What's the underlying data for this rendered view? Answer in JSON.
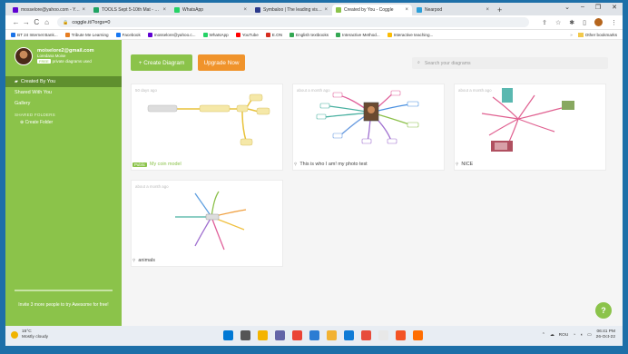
{
  "browser": {
    "tabs": [
      {
        "title": "mosselore@yahoo.com - Yahoo Mail",
        "color": "#6001d2",
        "active": false
      },
      {
        "title": "TOOLS Sept 5-10th Mat - Google Drive",
        "color": "#1fa463",
        "active": false
      },
      {
        "title": "WhatsApp",
        "color": "#25d366",
        "active": false
      },
      {
        "title": "Symbaloo | The leading visual bookmarking",
        "color": "#2b3a8c",
        "active": false
      },
      {
        "title": "Created by You - Coggle",
        "color": "#8bc34a",
        "active": true
      },
      {
        "title": "Nearpod",
        "color": "#2b9fd9",
        "active": false
      }
    ],
    "url": "coggle.it/?orgs=0",
    "bookmarks": [
      {
        "label": "BT 24 Internet Bank...",
        "color": "#1a73e8"
      },
      {
        "label": "Tribute Me Learning",
        "color": "#e67e22"
      },
      {
        "label": "Facebook",
        "color": "#1877f2"
      },
      {
        "label": "mosselore@yahoo.c...",
        "color": "#6001d2"
      },
      {
        "label": "WhatsApp",
        "color": "#25d366"
      },
      {
        "label": "YouTube",
        "color": "#ff0000"
      },
      {
        "label": "E.ON",
        "color": "#d62d20"
      },
      {
        "label": "English textbooks",
        "color": "#34a853"
      },
      {
        "label": "Interactive Method...",
        "color": "#34a853"
      },
      {
        "label": "Interactive teaching...",
        "color": "#fbbc04"
      }
    ],
    "other_bookmarks": "Other bookmarks"
  },
  "sidebar": {
    "email": "moiselore2@gmail.com",
    "name": "Loredana Moise",
    "plan_badge": "FREE",
    "plan_text": "private diagrams used",
    "items": [
      {
        "label": "Created By You",
        "active": true
      },
      {
        "label": "Shared With You",
        "active": false
      },
      {
        "label": "Gallery",
        "active": false
      }
    ],
    "shared_folders_heading": "SHARED FOLDERS",
    "create_folder": "Create Folder",
    "invite_text": "Invite 3 more people to try Awesome for free!",
    "invite_progress": 0.0
  },
  "main": {
    "create_label": "+ Create Diagram",
    "upgrade_label": "Upgrade Now",
    "search_placeholder": "Search your diagrams",
    "cards": [
      {
        "age": "50 days ago",
        "badge": "Public",
        "title": "My coin model",
        "locked": false
      },
      {
        "age": "about a month ago",
        "title": "This is who I am! my photo test",
        "locked": true
      },
      {
        "age": "about a month ago",
        "title": "NICE",
        "locked": true
      },
      {
        "age": "about a month ago",
        "title": "animals",
        "locked": true
      }
    ],
    "help_label": "?"
  },
  "taskbar": {
    "temperature": "15°C",
    "weather": "Mostly cloudy",
    "language": "ROU",
    "time": "06:41 PM",
    "date": "26-Oct-22",
    "app_colors": [
      "#0078d4",
      "#555555",
      "#f4b400",
      "#6264a7",
      "#ea4335",
      "#2b7cd3",
      "#f2b233",
      "#0f7bd6",
      "#e74c3c",
      "#e8e8e8",
      "#f35325",
      "#ff6d00"
    ]
  }
}
